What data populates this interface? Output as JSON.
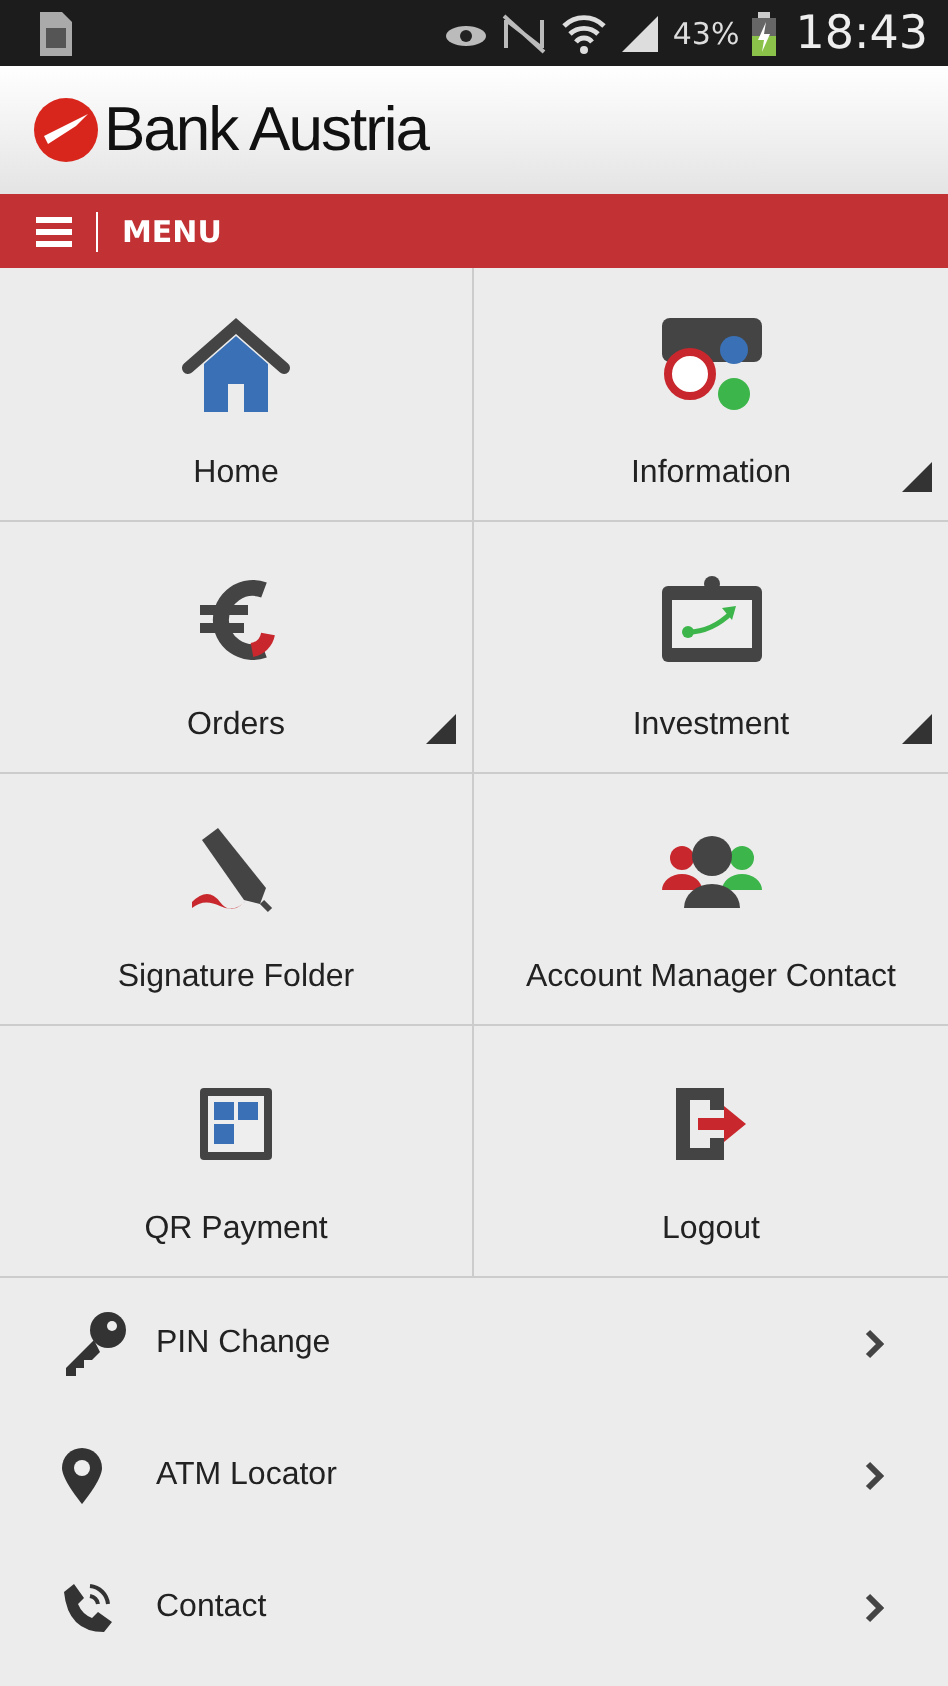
{
  "status_bar": {
    "battery": "43%",
    "time": "18:43"
  },
  "header": {
    "brand": "Bank Austria"
  },
  "menu_bar": {
    "label": "MENU"
  },
  "tiles": [
    {
      "label": "Home",
      "kind": "home",
      "submenu": false
    },
    {
      "label": "Information",
      "kind": "currency",
      "submenu": true
    },
    {
      "label": "Orders",
      "kind": "euro",
      "submenu": true
    },
    {
      "label": "Investment",
      "kind": "chart",
      "submenu": true
    },
    {
      "label": "Signature Folder",
      "kind": "pen",
      "submenu": false
    },
    {
      "label": "Account Manager Contact",
      "kind": "people",
      "submenu": false
    },
    {
      "label": "QR Payment",
      "kind": "qr",
      "submenu": false
    },
    {
      "label": "Logout",
      "kind": "logout",
      "submenu": false
    }
  ],
  "list": [
    {
      "label": "PIN Change",
      "kind": "key"
    },
    {
      "label": "ATM Locator",
      "kind": "pin"
    },
    {
      "label": "Contact",
      "kind": "phone"
    }
  ]
}
